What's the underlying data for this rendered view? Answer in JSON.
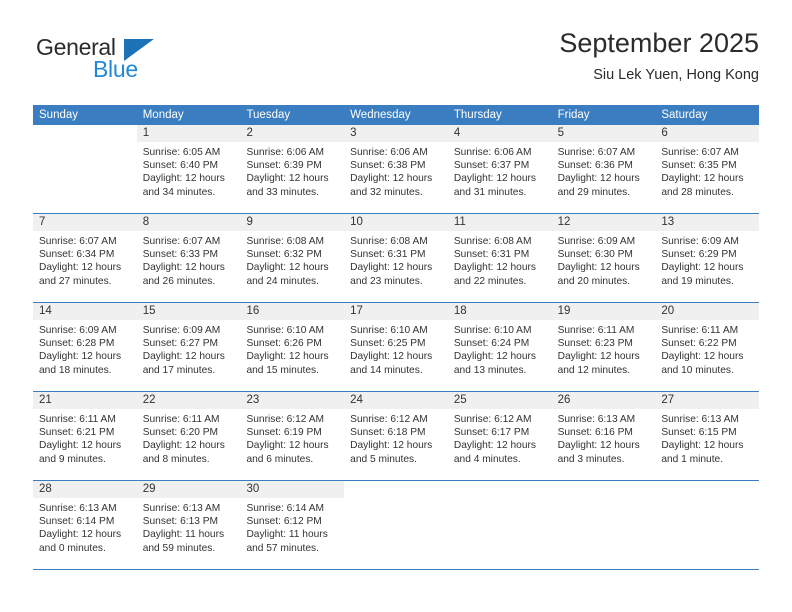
{
  "brand": {
    "name_part1": "General",
    "name_part2": "Blue",
    "accent_color": "#2389d6",
    "triangle_color": "#1e72b8"
  },
  "header": {
    "title": "September 2025",
    "subtitle": "Siu Lek Yuen, Hong Kong"
  },
  "theme": {
    "header_band": "#3a7dc0",
    "day_number_band": "#f0f0f0",
    "text": "#333333"
  },
  "weekdays": [
    "Sunday",
    "Monday",
    "Tuesday",
    "Wednesday",
    "Thursday",
    "Friday",
    "Saturday"
  ],
  "weeks": [
    [
      {
        "day": "",
        "sunrise": "",
        "sunset": "",
        "daylight_line1": "",
        "daylight_line2": ""
      },
      {
        "day": "1",
        "sunrise": "Sunrise: 6:05 AM",
        "sunset": "Sunset: 6:40 PM",
        "daylight_line1": "Daylight: 12 hours",
        "daylight_line2": "and 34 minutes."
      },
      {
        "day": "2",
        "sunrise": "Sunrise: 6:06 AM",
        "sunset": "Sunset: 6:39 PM",
        "daylight_line1": "Daylight: 12 hours",
        "daylight_line2": "and 33 minutes."
      },
      {
        "day": "3",
        "sunrise": "Sunrise: 6:06 AM",
        "sunset": "Sunset: 6:38 PM",
        "daylight_line1": "Daylight: 12 hours",
        "daylight_line2": "and 32 minutes."
      },
      {
        "day": "4",
        "sunrise": "Sunrise: 6:06 AM",
        "sunset": "Sunset: 6:37 PM",
        "daylight_line1": "Daylight: 12 hours",
        "daylight_line2": "and 31 minutes."
      },
      {
        "day": "5",
        "sunrise": "Sunrise: 6:07 AM",
        "sunset": "Sunset: 6:36 PM",
        "daylight_line1": "Daylight: 12 hours",
        "daylight_line2": "and 29 minutes."
      },
      {
        "day": "6",
        "sunrise": "Sunrise: 6:07 AM",
        "sunset": "Sunset: 6:35 PM",
        "daylight_line1": "Daylight: 12 hours",
        "daylight_line2": "and 28 minutes."
      }
    ],
    [
      {
        "day": "7",
        "sunrise": "Sunrise: 6:07 AM",
        "sunset": "Sunset: 6:34 PM",
        "daylight_line1": "Daylight: 12 hours",
        "daylight_line2": "and 27 minutes."
      },
      {
        "day": "8",
        "sunrise": "Sunrise: 6:07 AM",
        "sunset": "Sunset: 6:33 PM",
        "daylight_line1": "Daylight: 12 hours",
        "daylight_line2": "and 26 minutes."
      },
      {
        "day": "9",
        "sunrise": "Sunrise: 6:08 AM",
        "sunset": "Sunset: 6:32 PM",
        "daylight_line1": "Daylight: 12 hours",
        "daylight_line2": "and 24 minutes."
      },
      {
        "day": "10",
        "sunrise": "Sunrise: 6:08 AM",
        "sunset": "Sunset: 6:31 PM",
        "daylight_line1": "Daylight: 12 hours",
        "daylight_line2": "and 23 minutes."
      },
      {
        "day": "11",
        "sunrise": "Sunrise: 6:08 AM",
        "sunset": "Sunset: 6:31 PM",
        "daylight_line1": "Daylight: 12 hours",
        "daylight_line2": "and 22 minutes."
      },
      {
        "day": "12",
        "sunrise": "Sunrise: 6:09 AM",
        "sunset": "Sunset: 6:30 PM",
        "daylight_line1": "Daylight: 12 hours",
        "daylight_line2": "and 20 minutes."
      },
      {
        "day": "13",
        "sunrise": "Sunrise: 6:09 AM",
        "sunset": "Sunset: 6:29 PM",
        "daylight_line1": "Daylight: 12 hours",
        "daylight_line2": "and 19 minutes."
      }
    ],
    [
      {
        "day": "14",
        "sunrise": "Sunrise: 6:09 AM",
        "sunset": "Sunset: 6:28 PM",
        "daylight_line1": "Daylight: 12 hours",
        "daylight_line2": "and 18 minutes."
      },
      {
        "day": "15",
        "sunrise": "Sunrise: 6:09 AM",
        "sunset": "Sunset: 6:27 PM",
        "daylight_line1": "Daylight: 12 hours",
        "daylight_line2": "and 17 minutes."
      },
      {
        "day": "16",
        "sunrise": "Sunrise: 6:10 AM",
        "sunset": "Sunset: 6:26 PM",
        "daylight_line1": "Daylight: 12 hours",
        "daylight_line2": "and 15 minutes."
      },
      {
        "day": "17",
        "sunrise": "Sunrise: 6:10 AM",
        "sunset": "Sunset: 6:25 PM",
        "daylight_line1": "Daylight: 12 hours",
        "daylight_line2": "and 14 minutes."
      },
      {
        "day": "18",
        "sunrise": "Sunrise: 6:10 AM",
        "sunset": "Sunset: 6:24 PM",
        "daylight_line1": "Daylight: 12 hours",
        "daylight_line2": "and 13 minutes."
      },
      {
        "day": "19",
        "sunrise": "Sunrise: 6:11 AM",
        "sunset": "Sunset: 6:23 PM",
        "daylight_line1": "Daylight: 12 hours",
        "daylight_line2": "and 12 minutes."
      },
      {
        "day": "20",
        "sunrise": "Sunrise: 6:11 AM",
        "sunset": "Sunset: 6:22 PM",
        "daylight_line1": "Daylight: 12 hours",
        "daylight_line2": "and 10 minutes."
      }
    ],
    [
      {
        "day": "21",
        "sunrise": "Sunrise: 6:11 AM",
        "sunset": "Sunset: 6:21 PM",
        "daylight_line1": "Daylight: 12 hours",
        "daylight_line2": "and 9 minutes."
      },
      {
        "day": "22",
        "sunrise": "Sunrise: 6:11 AM",
        "sunset": "Sunset: 6:20 PM",
        "daylight_line1": "Daylight: 12 hours",
        "daylight_line2": "and 8 minutes."
      },
      {
        "day": "23",
        "sunrise": "Sunrise: 6:12 AM",
        "sunset": "Sunset: 6:19 PM",
        "daylight_line1": "Daylight: 12 hours",
        "daylight_line2": "and 6 minutes."
      },
      {
        "day": "24",
        "sunrise": "Sunrise: 6:12 AM",
        "sunset": "Sunset: 6:18 PM",
        "daylight_line1": "Daylight: 12 hours",
        "daylight_line2": "and 5 minutes."
      },
      {
        "day": "25",
        "sunrise": "Sunrise: 6:12 AM",
        "sunset": "Sunset: 6:17 PM",
        "daylight_line1": "Daylight: 12 hours",
        "daylight_line2": "and 4 minutes."
      },
      {
        "day": "26",
        "sunrise": "Sunrise: 6:13 AM",
        "sunset": "Sunset: 6:16 PM",
        "daylight_line1": "Daylight: 12 hours",
        "daylight_line2": "and 3 minutes."
      },
      {
        "day": "27",
        "sunrise": "Sunrise: 6:13 AM",
        "sunset": "Sunset: 6:15 PM",
        "daylight_line1": "Daylight: 12 hours",
        "daylight_line2": "and 1 minute."
      }
    ],
    [
      {
        "day": "28",
        "sunrise": "Sunrise: 6:13 AM",
        "sunset": "Sunset: 6:14 PM",
        "daylight_line1": "Daylight: 12 hours",
        "daylight_line2": "and 0 minutes."
      },
      {
        "day": "29",
        "sunrise": "Sunrise: 6:13 AM",
        "sunset": "Sunset: 6:13 PM",
        "daylight_line1": "Daylight: 11 hours",
        "daylight_line2": "and 59 minutes."
      },
      {
        "day": "30",
        "sunrise": "Sunrise: 6:14 AM",
        "sunset": "Sunset: 6:12 PM",
        "daylight_line1": "Daylight: 11 hours",
        "daylight_line2": "and 57 minutes."
      },
      {
        "day": "",
        "sunrise": "",
        "sunset": "",
        "daylight_line1": "",
        "daylight_line2": ""
      },
      {
        "day": "",
        "sunrise": "",
        "sunset": "",
        "daylight_line1": "",
        "daylight_line2": ""
      },
      {
        "day": "",
        "sunrise": "",
        "sunset": "",
        "daylight_line1": "",
        "daylight_line2": ""
      },
      {
        "day": "",
        "sunrise": "",
        "sunset": "",
        "daylight_line1": "",
        "daylight_line2": ""
      }
    ]
  ]
}
